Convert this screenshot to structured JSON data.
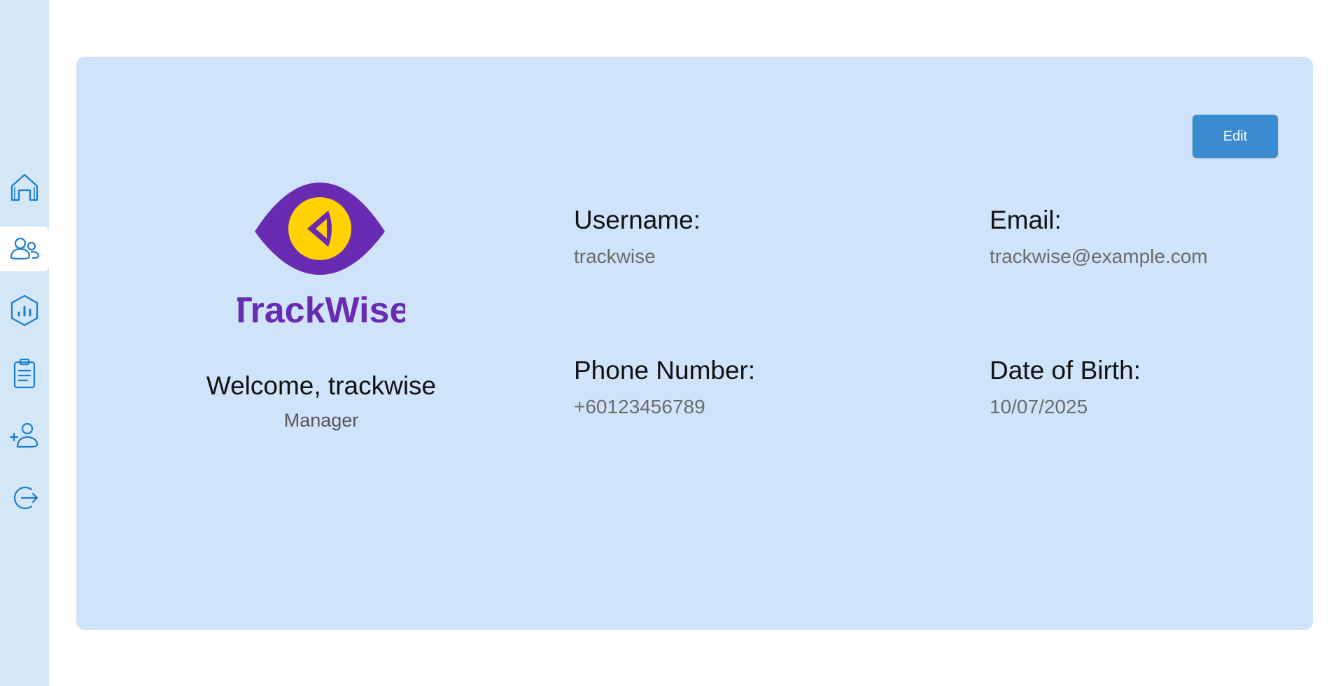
{
  "sidebar": {
    "items": [
      {
        "icon": "home-icon",
        "active": false
      },
      {
        "icon": "users-icon",
        "active": true
      },
      {
        "icon": "analytics-icon",
        "active": false
      },
      {
        "icon": "clipboard-icon",
        "active": false
      },
      {
        "icon": "add-user-icon",
        "active": false
      },
      {
        "icon": "logout-icon",
        "active": false
      }
    ],
    "accent_color": "#1a7dcc",
    "background_color": "#d3e7f7"
  },
  "profile": {
    "edit_label": "Edit",
    "logo_text": "TrackWise",
    "welcome": "Welcome, trackwise",
    "role": "Manager",
    "fields": {
      "username": {
        "label": "Username:",
        "value": "trackwise"
      },
      "email": {
        "label": "Email:",
        "value": "trackwise@example.com"
      },
      "phone": {
        "label": "Phone Number:",
        "value": "+60123456789"
      },
      "dob": {
        "label": "Date of Birth:",
        "value": "10/07/2025"
      }
    }
  },
  "colors": {
    "card_background": "#cfe4fa",
    "button": "#3a8bd0",
    "logo_purple": "#6a2bb3",
    "logo_yellow": "#ffd200"
  }
}
